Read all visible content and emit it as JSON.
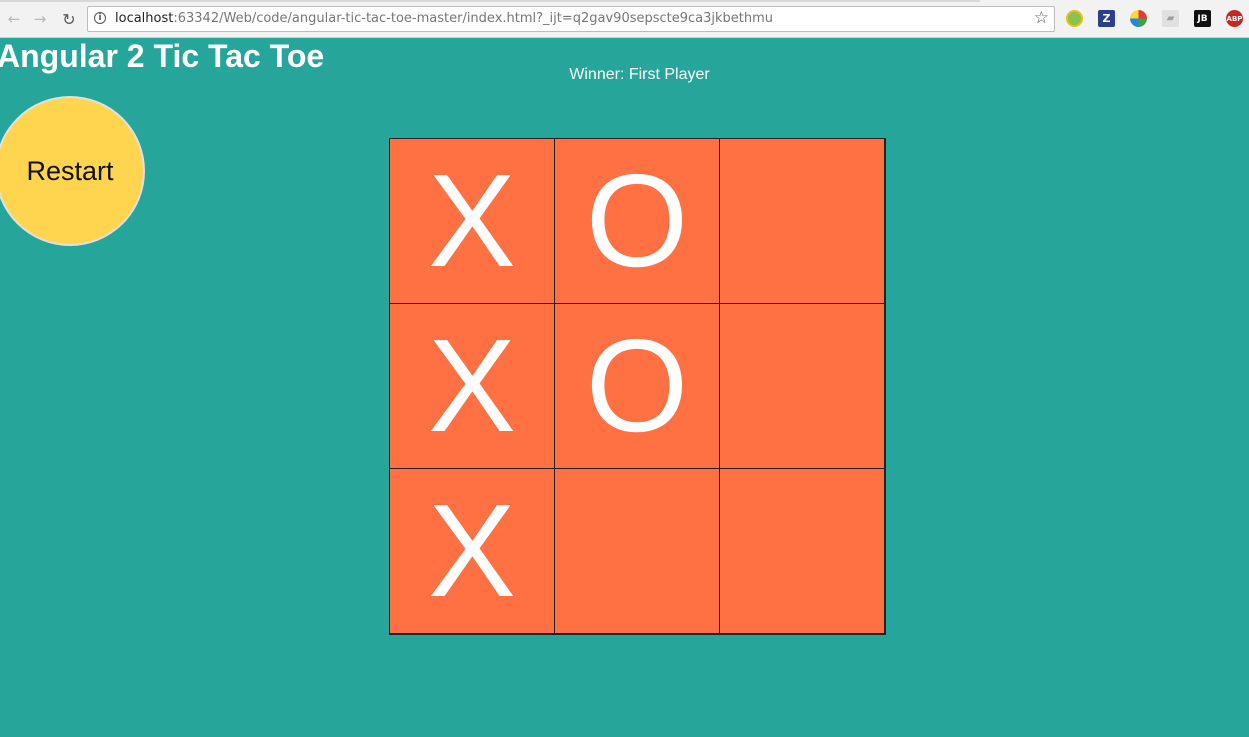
{
  "browser": {
    "url_host": "localhost",
    "url_rest": ":63342/Web/code/angular-tic-tac-toe-master/index.html?_ijt=q2gav90sepscte9ca3jkbethmu",
    "extensions": [
      {
        "name": "green-extension-icon",
        "glyph": ""
      },
      {
        "name": "zotero-icon",
        "glyph": "Z"
      },
      {
        "name": "color-wheel-icon",
        "glyph": ""
      },
      {
        "name": "pdf-icon",
        "glyph": "⸏"
      },
      {
        "name": "jetbrains-icon",
        "glyph": "JB"
      },
      {
        "name": "adblock-plus-icon",
        "glyph": "ABP"
      }
    ]
  },
  "page": {
    "title": "Angular 2 Tic Tac Toe",
    "status": "Winner: First Player",
    "restart_label": "Restart"
  },
  "board": {
    "cells": [
      "X",
      "O",
      "",
      "X",
      "O",
      "",
      "X",
      "",
      ""
    ]
  },
  "colors": {
    "background": "#26a69a",
    "cell": "#ff7043",
    "restart": "#ffd54f",
    "mark": "#ffffff"
  }
}
